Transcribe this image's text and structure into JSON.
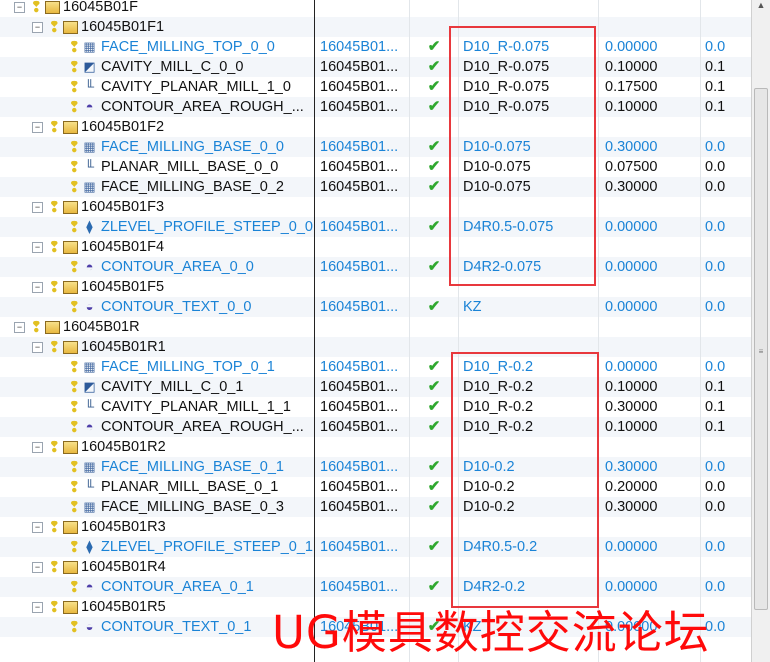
{
  "rows": [
    {
      "level": 0,
      "type": "group",
      "name": "16045B01F",
      "expanded": true
    },
    {
      "level": 1,
      "type": "group",
      "name": "16045B01F1",
      "expanded": true
    },
    {
      "level": 2,
      "type": "op",
      "icon": "face-milling-icon",
      "name": "FACE_MILLING_TOP_0_0",
      "program": "16045B01...",
      "tool": "D10_R-0.075",
      "stock": "0.00000",
      "next": "0.0",
      "highlight": true
    },
    {
      "level": 2,
      "type": "op",
      "icon": "cavity-mill-icon",
      "name": "CAVITY_MILL_C_0_0",
      "program": "16045B01...",
      "tool": "D10_R-0.075",
      "stock": "0.10000",
      "next": "0.1",
      "highlight": false
    },
    {
      "level": 2,
      "type": "op",
      "icon": "planar-mill-icon",
      "name": "CAVITY_PLANAR_MILL_1_0",
      "program": "16045B01...",
      "tool": "D10_R-0.075",
      "stock": "0.17500",
      "next": "0.1",
      "highlight": false
    },
    {
      "level": 2,
      "type": "op",
      "icon": "contour-area-icon",
      "name": "CONTOUR_AREA_ROUGH_...",
      "program": "16045B01...",
      "tool": "D10_R-0.075",
      "stock": "0.10000",
      "next": "0.1",
      "highlight": false
    },
    {
      "level": 1,
      "type": "group",
      "name": "16045B01F2",
      "expanded": true
    },
    {
      "level": 2,
      "type": "op",
      "icon": "face-milling-icon",
      "name": "FACE_MILLING_BASE_0_0",
      "program": "16045B01...",
      "tool": "D10-0.075",
      "stock": "0.30000",
      "next": "0.0",
      "highlight": true
    },
    {
      "level": 2,
      "type": "op",
      "icon": "planar-mill-icon",
      "name": "PLANAR_MILL_BASE_0_0",
      "program": "16045B01...",
      "tool": "D10-0.075",
      "stock": "0.07500",
      "next": "0.0",
      "highlight": false
    },
    {
      "level": 2,
      "type": "op",
      "icon": "face-milling-icon",
      "name": "FACE_MILLING_BASE_0_2",
      "program": "16045B01...",
      "tool": "D10-0.075",
      "stock": "0.30000",
      "next": "0.0",
      "highlight": false
    },
    {
      "level": 1,
      "type": "group",
      "name": "16045B01F3",
      "expanded": true
    },
    {
      "level": 2,
      "type": "op",
      "icon": "zlevel-profile-icon",
      "name": "ZLEVEL_PROFILE_STEEP_0_0",
      "program": "16045B01...",
      "tool": "D4R0.5-0.075",
      "stock": "0.00000",
      "next": "0.0",
      "highlight": true
    },
    {
      "level": 1,
      "type": "group",
      "name": "16045B01F4",
      "expanded": true
    },
    {
      "level": 2,
      "type": "op",
      "icon": "contour-area-icon",
      "name": "CONTOUR_AREA_0_0",
      "program": "16045B01...",
      "tool": "D4R2-0.075",
      "stock": "0.00000",
      "next": "0.0",
      "highlight": true
    },
    {
      "level": 1,
      "type": "group",
      "name": "16045B01F5",
      "expanded": true
    },
    {
      "level": 2,
      "type": "op",
      "icon": "contour-text-icon",
      "name": "CONTOUR_TEXT_0_0",
      "program": "16045B01...",
      "tool": "KZ",
      "stock": "0.00000",
      "next": "0.0",
      "highlight": true
    },
    {
      "level": 0,
      "type": "group",
      "name": "16045B01R",
      "expanded": true
    },
    {
      "level": 1,
      "type": "group",
      "name": "16045B01R1",
      "expanded": true
    },
    {
      "level": 2,
      "type": "op",
      "icon": "face-milling-icon",
      "name": "FACE_MILLING_TOP_0_1",
      "program": "16045B01...",
      "tool": "D10_R-0.2",
      "stock": "0.00000",
      "next": "0.0",
      "highlight": true
    },
    {
      "level": 2,
      "type": "op",
      "icon": "cavity-mill-icon",
      "name": "CAVITY_MILL_C_0_1",
      "program": "16045B01...",
      "tool": "D10_R-0.2",
      "stock": "0.10000",
      "next": "0.1",
      "highlight": false
    },
    {
      "level": 2,
      "type": "op",
      "icon": "planar-mill-icon",
      "name": "CAVITY_PLANAR_MILL_1_1",
      "program": "16045B01...",
      "tool": "D10_R-0.2",
      "stock": "0.30000",
      "next": "0.1",
      "highlight": false
    },
    {
      "level": 2,
      "type": "op",
      "icon": "contour-area-icon",
      "name": "CONTOUR_AREA_ROUGH_...",
      "program": "16045B01...",
      "tool": "D10_R-0.2",
      "stock": "0.10000",
      "next": "0.1",
      "highlight": false
    },
    {
      "level": 1,
      "type": "group",
      "name": "16045B01R2",
      "expanded": true
    },
    {
      "level": 2,
      "type": "op",
      "icon": "face-milling-icon",
      "name": "FACE_MILLING_BASE_0_1",
      "program": "16045B01...",
      "tool": "D10-0.2",
      "stock": "0.30000",
      "next": "0.0",
      "highlight": true
    },
    {
      "level": 2,
      "type": "op",
      "icon": "planar-mill-icon",
      "name": "PLANAR_MILL_BASE_0_1",
      "program": "16045B01...",
      "tool": "D10-0.2",
      "stock": "0.20000",
      "next": "0.0",
      "highlight": false
    },
    {
      "level": 2,
      "type": "op",
      "icon": "face-milling-icon",
      "name": "FACE_MILLING_BASE_0_3",
      "program": "16045B01...",
      "tool": "D10-0.2",
      "stock": "0.30000",
      "next": "0.0",
      "highlight": false
    },
    {
      "level": 1,
      "type": "group",
      "name": "16045B01R3",
      "expanded": true
    },
    {
      "level": 2,
      "type": "op",
      "icon": "zlevel-profile-icon",
      "name": "ZLEVEL_PROFILE_STEEP_0_1",
      "program": "16045B01...",
      "tool": "D4R0.5-0.2",
      "stock": "0.00000",
      "next": "0.0",
      "highlight": true
    },
    {
      "level": 1,
      "type": "group",
      "name": "16045B01R4",
      "expanded": true
    },
    {
      "level": 2,
      "type": "op",
      "icon": "contour-area-icon",
      "name": "CONTOUR_AREA_0_1",
      "program": "16045B01...",
      "tool": "D4R2-0.2",
      "stock": "0.00000",
      "next": "0.0",
      "highlight": true
    },
    {
      "level": 1,
      "type": "group",
      "name": "16045B01R5",
      "expanded": true
    },
    {
      "level": 2,
      "type": "op",
      "icon": "contour-text-icon",
      "name": "CONTOUR_TEXT_0_1",
      "program": "16045B01...",
      "tool": "KZ",
      "stock": "0.00000",
      "next": "0.0",
      "highlight": true
    }
  ],
  "watermark": "UG模具数控交流论坛",
  "colors": {
    "highlight_text": "#1a83d6",
    "check": "#2fa82f",
    "red_box": "#e8383d",
    "watermark": "#ff0a0a"
  }
}
